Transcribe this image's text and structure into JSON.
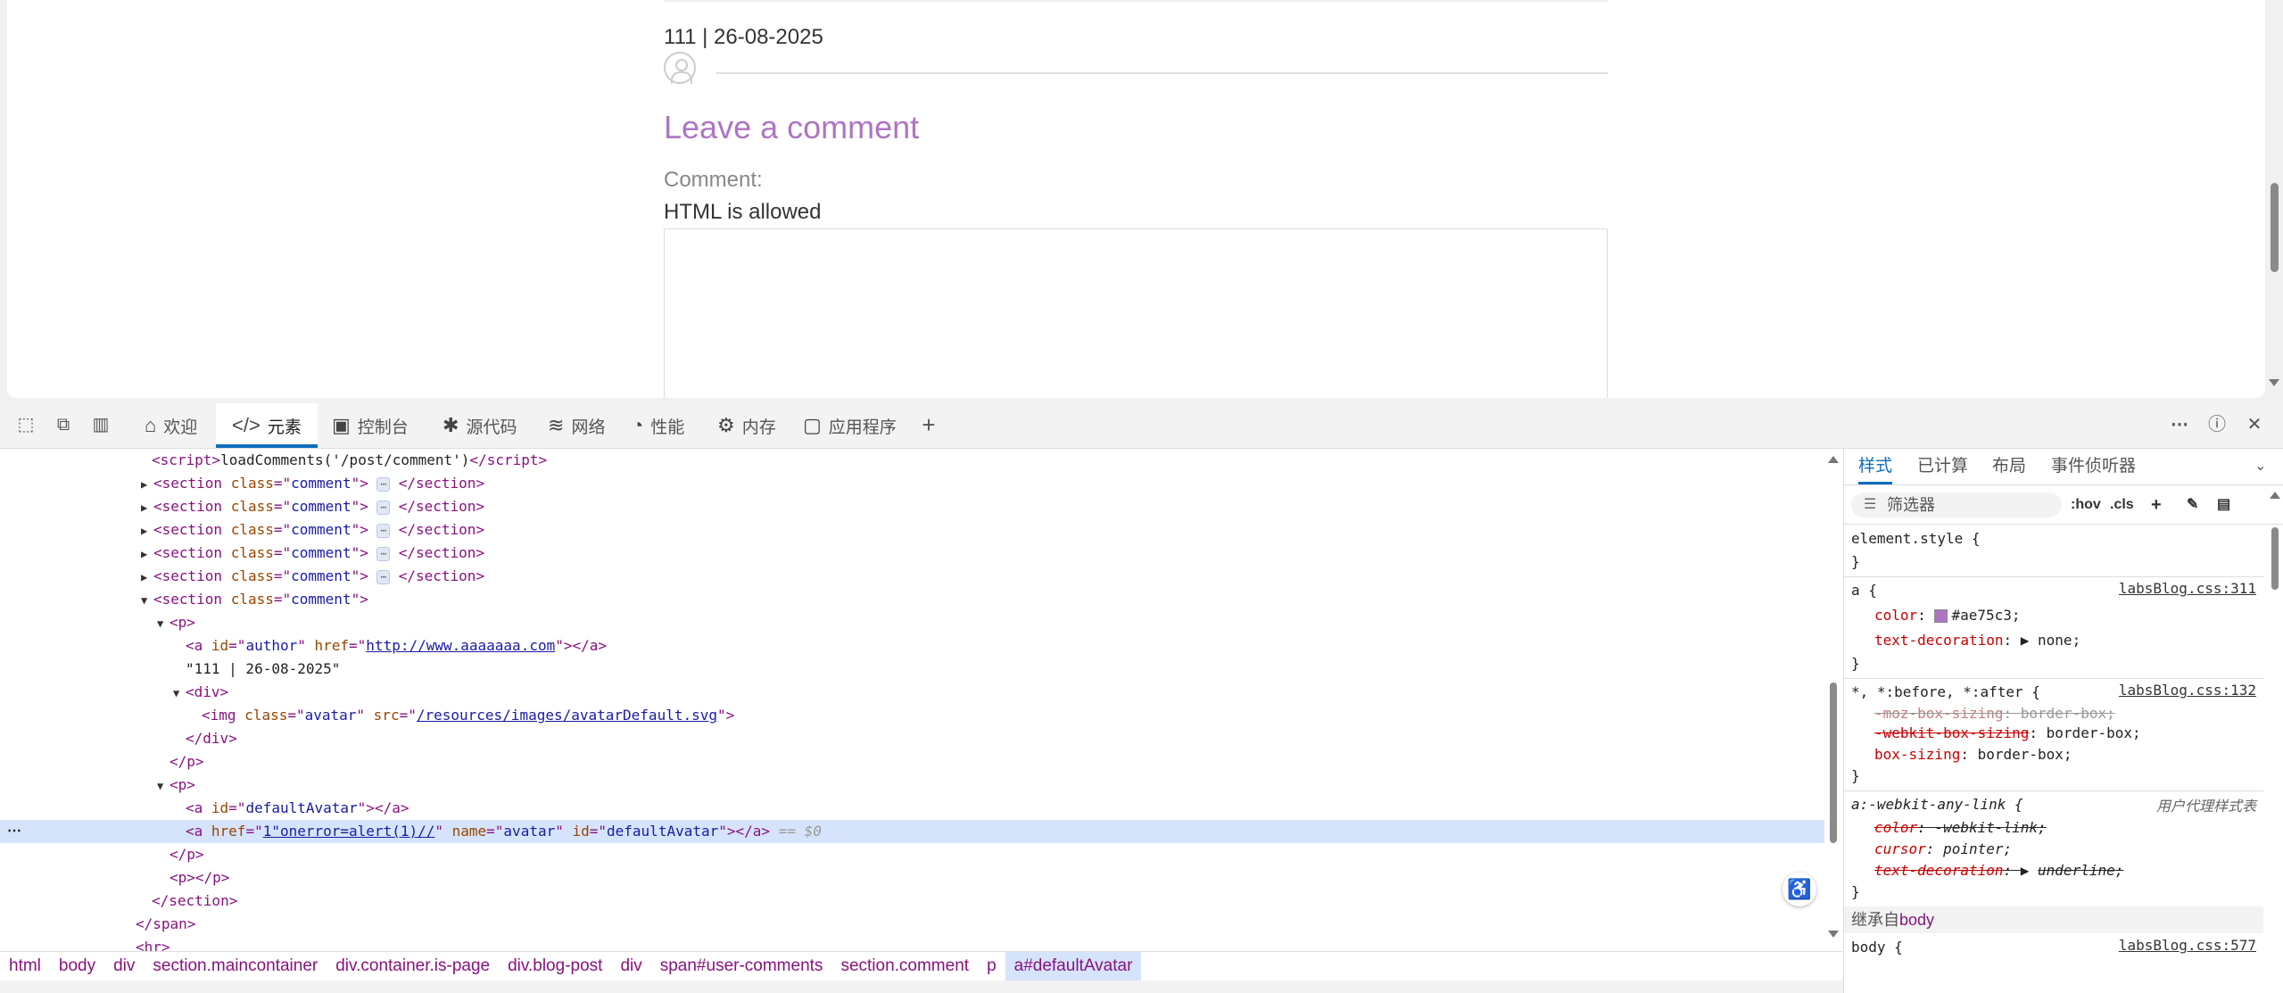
{
  "page": {
    "meta": "111 | 26-08-2025",
    "leave_comment": "Leave a comment",
    "comment_label": "Comment:",
    "html_allowed": "HTML is allowed"
  },
  "toolbar": {
    "tabs": [
      {
        "label": "欢迎",
        "icon": "home-icon"
      },
      {
        "label": "元素",
        "icon": "code-icon"
      },
      {
        "label": "控制台",
        "icon": "console-icon"
      },
      {
        "label": "源代码",
        "icon": "bug-icon"
      },
      {
        "label": "网络",
        "icon": "wifi-icon"
      },
      {
        "label": "性能",
        "icon": "gauge-icon"
      },
      {
        "label": "内存",
        "icon": "chip-icon"
      },
      {
        "label": "应用程序",
        "icon": "app-icon"
      }
    ]
  },
  "dom": {
    "script_text": "loadComments('/post/comment')",
    "comment_class": "comment",
    "author_id": "author",
    "author_href": "http://www.aaaaaaa.com",
    "comment_text": "\"111 | 26-08-2025\"",
    "img_class": "avatar",
    "img_src": "/resources/images/avatarDefault.svg",
    "default_avatar_id": "defaultAvatar",
    "sel_href": "1\"onerror=alert(1)//",
    "sel_name": "avatar",
    "sel_id": "defaultAvatar",
    "sel_marker": "== $0"
  },
  "breadcrumb": [
    "html",
    "body",
    "div",
    "section.maincontainer",
    "div.container.is-page",
    "div.blog-post",
    "div",
    "span#user-comments",
    "section.comment",
    "p",
    "a#defaultAvatar"
  ],
  "styles": {
    "tabs": [
      "样式",
      "已计算",
      "布局",
      "事件侦听器"
    ],
    "filter_placeholder": "筛选器",
    "hov": ":hov",
    "cls": ".cls",
    "element_style": "element.style {",
    "a_selector": "a {",
    "a_source": "labsBlog.css:311",
    "color_value": "#ae75c3;",
    "td_value": "none;",
    "star_selector": "*, *:before, *:after {",
    "star_source": "labsBlog.css:132",
    "moz_value": "border-box;",
    "webkit_value": "border-box;",
    "box_value": "border-box;",
    "any_link_selector": "a:-webkit-any-link {",
    "ua_label": "用户代理样式表",
    "wk_color_value": "-webkit-link;",
    "cursor_value": "pointer;",
    "ul_value": "underline;",
    "inherited_label": "继承自",
    "inherited_from": "body",
    "body_selector": "body {",
    "body_source": "labsBlog.css:577"
  },
  "colors": {
    "accent": "#ae75c3",
    "devtools_blue": "#0f6cbd"
  }
}
